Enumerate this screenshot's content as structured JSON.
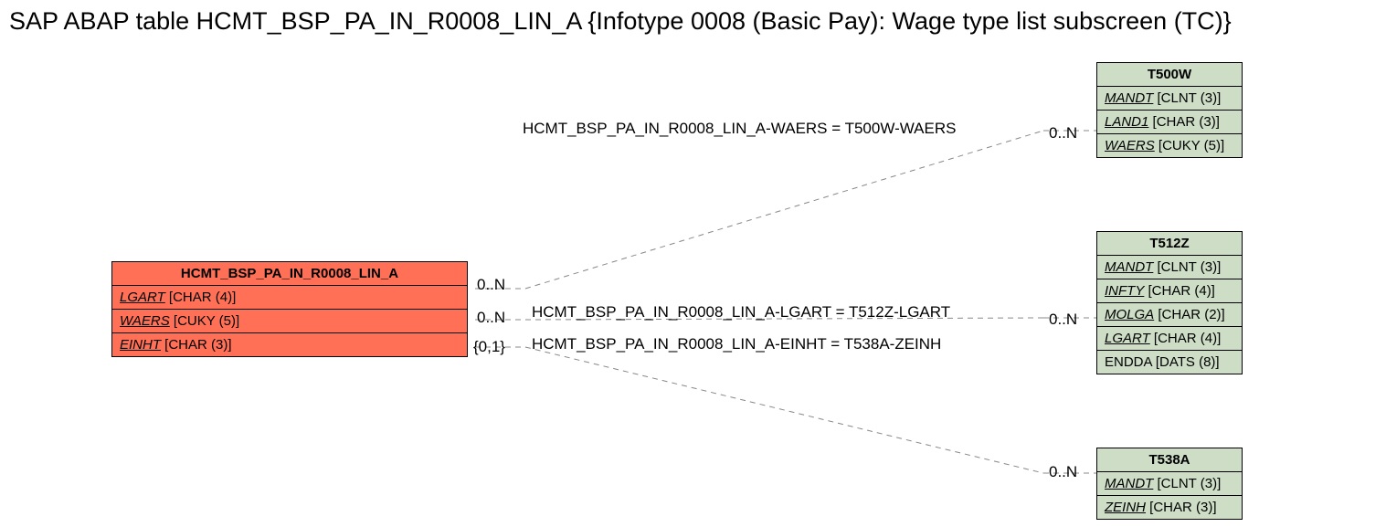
{
  "title": "SAP ABAP table HCMT_BSP_PA_IN_R0008_LIN_A {Infotype 0008 (Basic Pay): Wage type list subscreen (TC)}",
  "main": {
    "name": "HCMT_BSP_PA_IN_R0008_LIN_A",
    "fields": [
      {
        "name": "LGART",
        "type": "[CHAR (4)]"
      },
      {
        "name": "WAERS",
        "type": "[CUKY (5)]"
      },
      {
        "name": "EINHT",
        "type": "[CHAR (3)]"
      }
    ]
  },
  "refs": {
    "t500w": {
      "name": "T500W",
      "fields": [
        {
          "name": "MANDT",
          "type": "[CLNT (3)]"
        },
        {
          "name": "LAND1",
          "type": "[CHAR (3)]"
        },
        {
          "name": "WAERS",
          "type": "[CUKY (5)]"
        }
      ]
    },
    "t512z": {
      "name": "T512Z",
      "fields": [
        {
          "name": "MANDT",
          "type": "[CLNT (3)]"
        },
        {
          "name": "INFTY",
          "type": "[CHAR (4)]"
        },
        {
          "name": "MOLGA",
          "type": "[CHAR (2)]"
        },
        {
          "name": "LGART",
          "type": "[CHAR (4)]"
        },
        {
          "name": "ENDDA",
          "type": "[DATS (8)]"
        }
      ]
    },
    "t538a": {
      "name": "T538A",
      "fields": [
        {
          "name": "MANDT",
          "type": "[CLNT (3)]"
        },
        {
          "name": "ZEINH",
          "type": "[CHAR (3)]"
        }
      ]
    }
  },
  "rel": {
    "r1": {
      "text": "HCMT_BSP_PA_IN_R0008_LIN_A-WAERS = T500W-WAERS",
      "leftCard": "0..N",
      "rightCard": "0..N"
    },
    "r2": {
      "text": "HCMT_BSP_PA_IN_R0008_LIN_A-LGART = T512Z-LGART",
      "leftCard": "0..N",
      "rightCard": "0..N"
    },
    "r3": {
      "text": "HCMT_BSP_PA_IN_R0008_LIN_A-EINHT = T538A-ZEINH",
      "leftCard": "{0,1}",
      "rightCard": "0..N"
    }
  }
}
